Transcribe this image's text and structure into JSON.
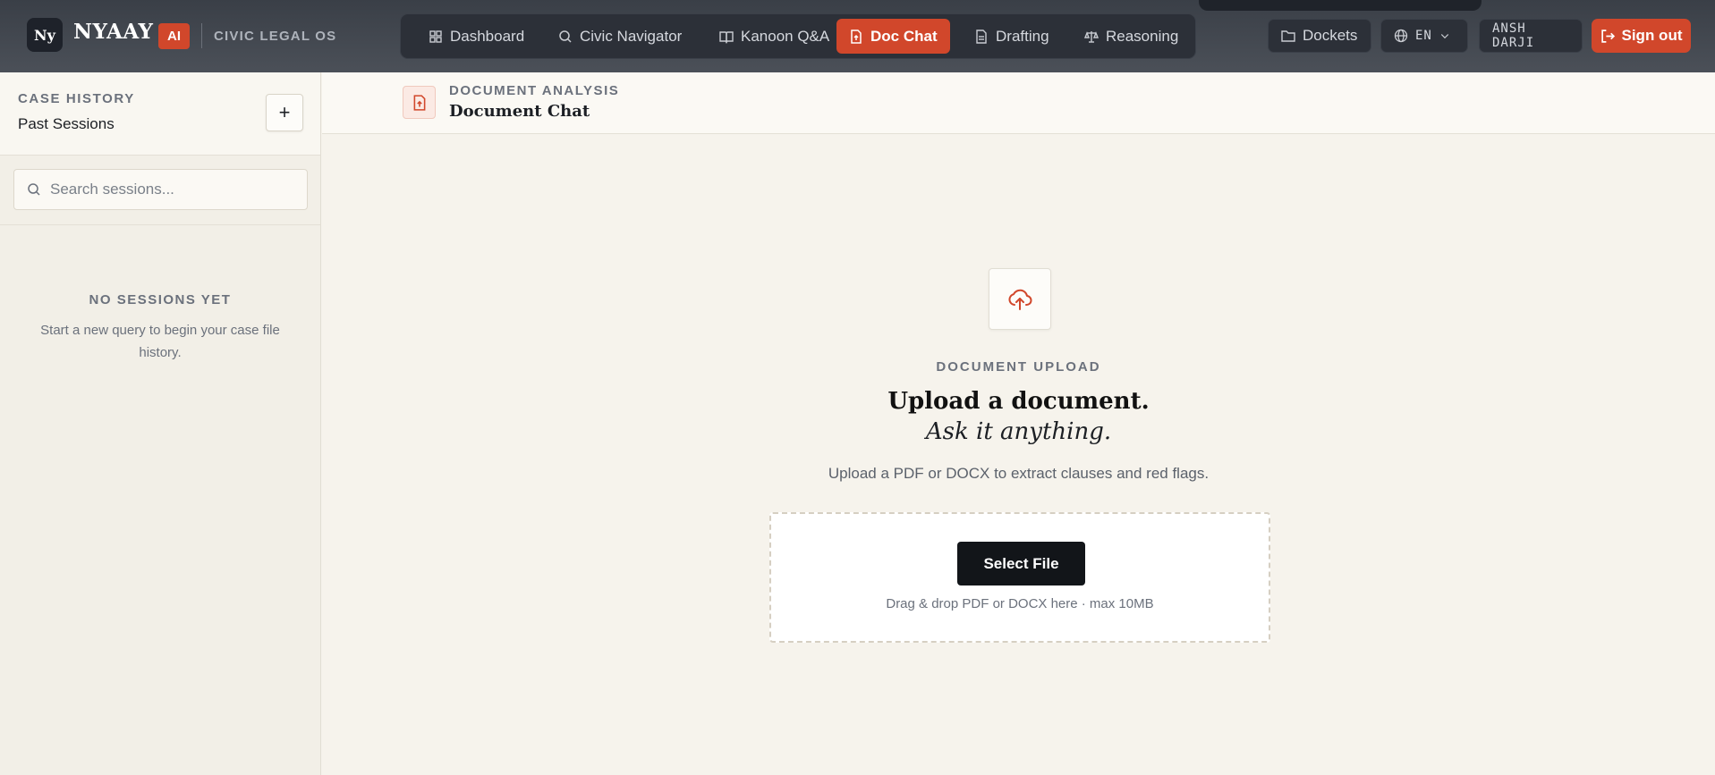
{
  "brand": {
    "logo_mark": "Ny",
    "name": "NYAAY",
    "badge": "AI",
    "subtitle": "CIVIC LEGAL OS"
  },
  "nav": {
    "items": [
      {
        "label": "Dashboard",
        "icon": "grid-icon"
      },
      {
        "label": "Civic Navigator",
        "icon": "search-icon"
      },
      {
        "label": "Kanoon Q&A",
        "icon": "book-icon"
      },
      {
        "label": "Doc Chat",
        "icon": "file-upload-icon",
        "active": true
      },
      {
        "label": "Drafting",
        "icon": "file-text-icon"
      },
      {
        "label": "Reasoning",
        "icon": "scale-icon"
      }
    ]
  },
  "header_right": {
    "dockets_label": "Dockets",
    "language": "EN",
    "user": "ANSH DARJI",
    "signout_label": "Sign out"
  },
  "sidebar": {
    "kicker": "CASE HISTORY",
    "title": "Past Sessions",
    "add_symbol": "+",
    "search_placeholder": "Search sessions...",
    "empty_title": "NO SESSIONS YET",
    "empty_desc": "Start a new query to begin your case file history."
  },
  "content_header": {
    "kicker": "DOCUMENT ANALYSIS",
    "title": "Document Chat"
  },
  "upload": {
    "kicker": "DOCUMENT UPLOAD",
    "title": "Upload a document.",
    "subtitle": "Ask it anything.",
    "description": "Upload a PDF or DOCX to extract clauses and red flags.",
    "button_label": "Select File",
    "hint": "Drag & drop PDF or DOCX here · max 10MB"
  },
  "colors": {
    "accent": "#d1472b",
    "topbar": "#3a3f47",
    "background": "#f6f3ec"
  }
}
